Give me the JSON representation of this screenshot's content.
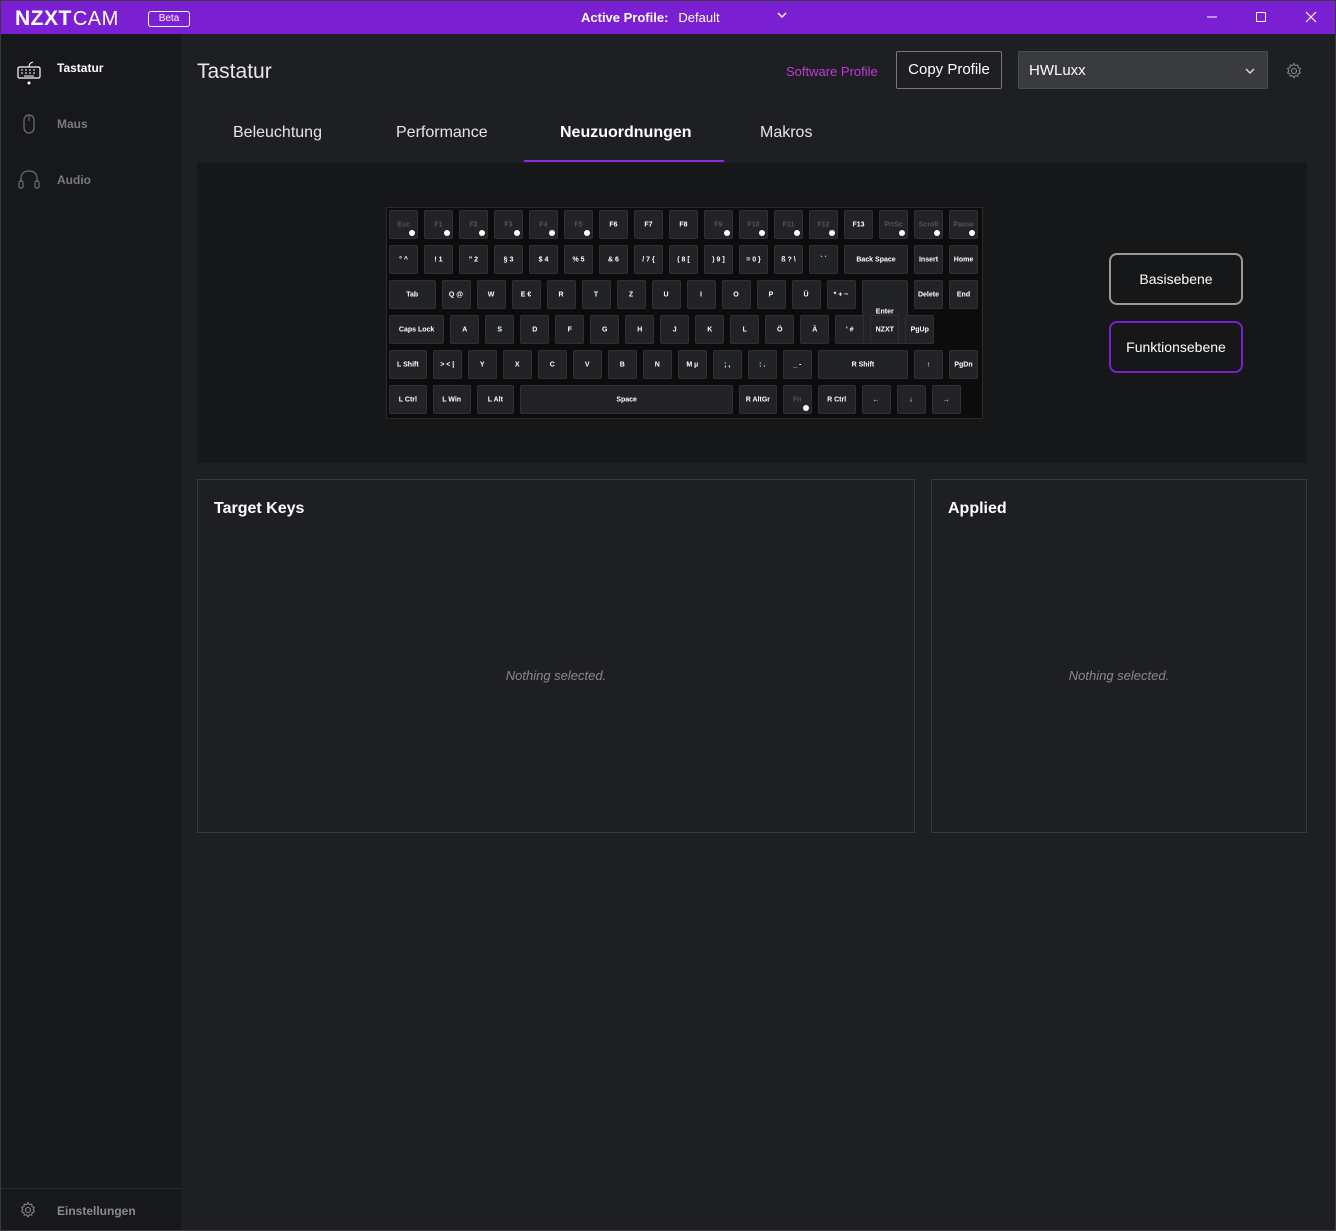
{
  "titlebar": {
    "logo": "NZXT",
    "logo_cam": "CAM",
    "beta": "Beta",
    "active_profile_label": "Active Profile:",
    "active_profile_value": "Default"
  },
  "sidebar": {
    "items": [
      {
        "label": "Tastatur",
        "icon": "keyboard-icon",
        "active": true
      },
      {
        "label": "Maus",
        "icon": "mouse-icon",
        "active": false
      },
      {
        "label": "Audio",
        "icon": "headset-icon",
        "active": false
      }
    ],
    "settings_label": "Einstellungen"
  },
  "header": {
    "title": "Tastatur",
    "software_profile": "Software Profile",
    "copy_profile": "Copy Profile",
    "profile_select": "HWLuxx"
  },
  "tabs": [
    "Beleuchtung",
    "Performance",
    "Neuzuordnungen",
    "Makros"
  ],
  "active_tab": "Neuzuordnungen",
  "keyboard": {
    "row1": [
      "Esc",
      "F1",
      "F2",
      "F3",
      "F4",
      "F5",
      "F6",
      "F7",
      "F8",
      "F9",
      "F10",
      "F11",
      "F12",
      "F13",
      "PrtSc",
      "Scroll",
      "Pause"
    ],
    "row2": [
      "° ^",
      "! 1",
      "\" 2",
      "§ 3",
      "$ 4",
      "% 5",
      "& 6",
      "/ 7 {",
      "( 8 [",
      ") 9 ]",
      "= 0 }",
      "ß ? \\",
      "` ´",
      "Back Space",
      "Insert",
      "Home"
    ],
    "row3": [
      "Tab",
      "Q @",
      "W",
      "E €",
      "R",
      "T",
      "Z",
      "U",
      "I",
      "O",
      "P",
      "Ü",
      "* + ~",
      "Enter",
      "Delete",
      "End"
    ],
    "row4": [
      "Caps Lock",
      "A",
      "S",
      "D",
      "F",
      "G",
      "H",
      "J",
      "K",
      "L",
      "Ö",
      "Ä",
      "' #",
      "NZXT",
      "PgUp"
    ],
    "row5": [
      "L Shift",
      "> < |",
      "Y",
      "X",
      "C",
      "V",
      "B",
      "N",
      "M µ",
      "; ,",
      ": .",
      "_ -",
      "R Shift",
      "↑",
      "PgDn"
    ],
    "row6": [
      "L Ctrl",
      "L Win",
      "L Alt",
      "Space",
      "R AltGr",
      "Fn",
      "R Ctrl",
      "←",
      "↓",
      "→"
    ]
  },
  "layers": {
    "base": "Basisebene",
    "fn": "Funktionsebene"
  },
  "panels": {
    "target_title": "Target Keys",
    "target_empty": "Nothing selected.",
    "applied_title": "Applied",
    "applied_empty": "Nothing selected."
  }
}
